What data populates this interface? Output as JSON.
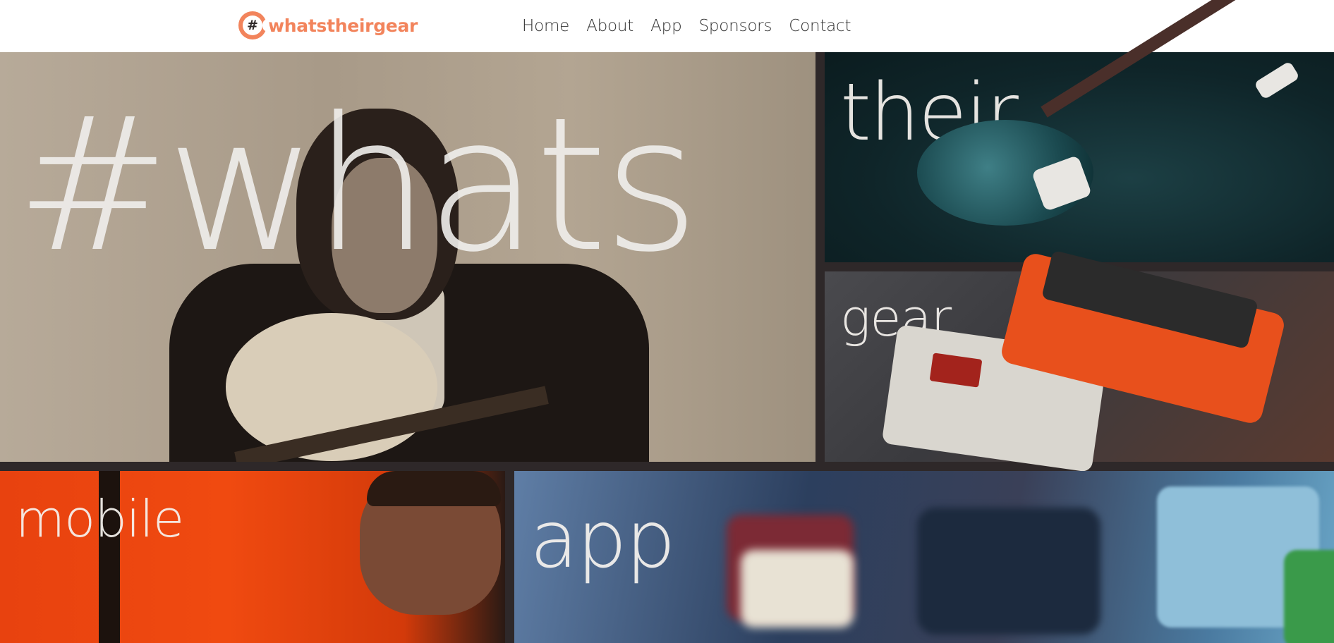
{
  "brand": {
    "icon_glyph": "#",
    "name": "whatstheirgear",
    "color": "#f2845c"
  },
  "nav": {
    "items": [
      {
        "label": "Home"
      },
      {
        "label": "About"
      },
      {
        "label": "App"
      },
      {
        "label": "Sponsors"
      },
      {
        "label": "Contact"
      }
    ]
  },
  "tiles": {
    "whats": {
      "word": "#whats"
    },
    "their": {
      "word": "their"
    },
    "gear": {
      "word": "gear"
    },
    "mobile": {
      "word": "mobile"
    },
    "app": {
      "word": "app"
    }
  }
}
